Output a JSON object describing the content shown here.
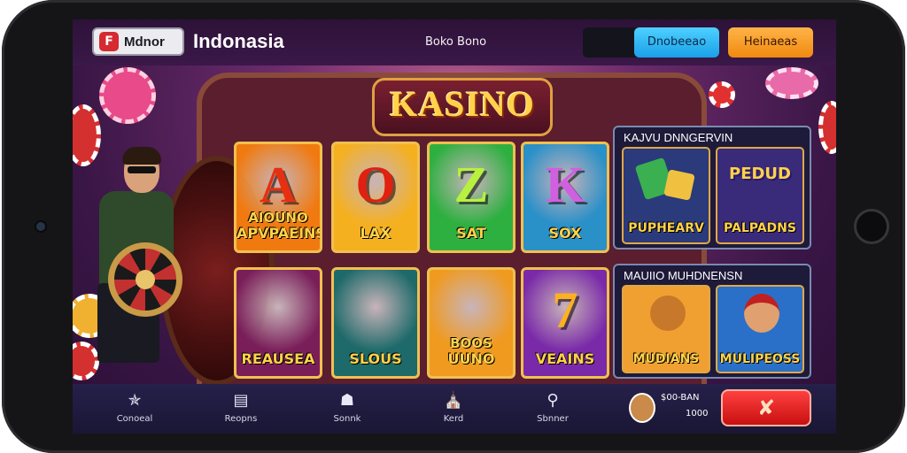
{
  "header": {
    "logo_icon": "F",
    "logo_text": "Mdnor",
    "brand": "Indonasia",
    "subtitle": "Boko Bono",
    "button_blue": "Dnobeeao",
    "button_orange": "Heinaeas"
  },
  "main": {
    "title": "KASINO"
  },
  "games": [
    {
      "big": "A",
      "sub": "AIOUNO",
      "label": "APVPAEINS",
      "bg": "#f07a10",
      "color": "#e63010"
    },
    {
      "big": "O",
      "sub": "",
      "label": "LAX",
      "bg": "#f5b020",
      "color": "#e02010"
    },
    {
      "big": "Z",
      "sub": "",
      "label": "SAT",
      "bg": "#2eb040",
      "color": "#b8f040"
    },
    {
      "big": "K",
      "sub": "",
      "label": "SOX",
      "bg": "#2a90c8",
      "color": "#d060e0"
    },
    {
      "big": "",
      "sub": "",
      "label": "REAUSEA",
      "bg": "#7a1e5a",
      "color": "#ffd24a"
    },
    {
      "big": "",
      "sub": "",
      "label": "SLOUS",
      "bg": "#1e6a6a",
      "color": "#ffd24a"
    },
    {
      "big": "",
      "sub": "BOOS",
      "label": "UUNO",
      "bg": "#f09a20",
      "color": "#5a2a0a"
    },
    {
      "big": "7",
      "sub": "",
      "label": "VEAINS",
      "bg": "#7a2aa8",
      "color": "#ffb020"
    }
  ],
  "panels": {
    "top": {
      "title": "KAJVU DNNGERVIN",
      "tiles": [
        {
          "label": "PUPHEARV",
          "bg": "#2a3a7a"
        },
        {
          "label": "PALPADNS",
          "bg": "#3a2a7a",
          "badge": "PEDUD"
        }
      ]
    },
    "bottom": {
      "title": "MAUIIO MUHDNENSN",
      "tiles": [
        {
          "label": "MUDIANS",
          "bg": "#f0a030"
        },
        {
          "label": "MULIPEOSS",
          "bg": "#2a70c8"
        }
      ]
    }
  },
  "bottom_nav": {
    "items": [
      {
        "label": "Conoeal",
        "icon": "chip-icon"
      },
      {
        "label": "Reopns",
        "icon": "document-icon"
      },
      {
        "label": "Sonnk",
        "icon": "chef-hat-icon"
      },
      {
        "label": "Kerd",
        "icon": "shield-icon"
      },
      {
        "label": "Sbnner",
        "icon": "search-icon"
      }
    ],
    "balance_line1": "$00-BAN",
    "balance_line2": "1000",
    "spin_label": "spin-icon"
  },
  "colors": {
    "accent_blue": "#1aa0e8",
    "accent_orange": "#f08a10",
    "spin_red": "#c81010",
    "title_gold": "#ffd24a"
  }
}
